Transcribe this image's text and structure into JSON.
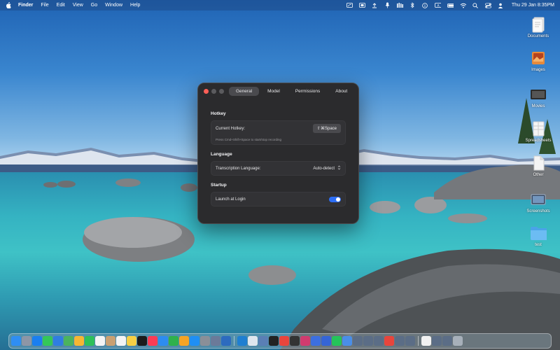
{
  "menubar": {
    "app_name": "Finder",
    "items": [
      "File",
      "Edit",
      "View",
      "Go",
      "Window",
      "Help"
    ],
    "status_icons": [
      "screen-record-icon",
      "screenshot-icon",
      "upload-icon",
      "microphone-icon",
      "audio-meter-icon",
      "bluetooth-icon",
      "info-icon",
      "input-source-icon",
      "battery-icon",
      "wifi-icon",
      "search-icon",
      "control-center-icon",
      "user-icon"
    ],
    "clock": "Thu 29 Jan  8:35PM"
  },
  "desktop": {
    "icons": [
      {
        "label": "Documents",
        "icon": "document-stack-icon"
      },
      {
        "label": "Images",
        "icon": "image-stack-icon"
      },
      {
        "label": "Movies",
        "icon": "movie-stack-icon"
      },
      {
        "label": "Spreadsheets",
        "icon": "spreadsheet-stack-icon"
      },
      {
        "label": "Other",
        "icon": "other-stack-icon"
      },
      {
        "label": "Screenshots",
        "icon": "screenshot-stack-icon"
      },
      {
        "label": "test",
        "icon": "folder-icon"
      }
    ]
  },
  "window": {
    "tabs": [
      {
        "label": "General",
        "active": true
      },
      {
        "label": "Model",
        "active": false
      },
      {
        "label": "Permissions",
        "active": false
      },
      {
        "label": "About",
        "active": false
      }
    ],
    "hotkey": {
      "section_title": "Hotkey",
      "label": "Current Hotkey:",
      "value": "⇧⌘Space",
      "hint": "Press Cmd+Shift+Space to start/stop recording"
    },
    "language": {
      "section_title": "Language",
      "label": "Transcription Language:",
      "value": "Auto-detect"
    },
    "startup": {
      "section_title": "Startup",
      "label": "Launch at Login",
      "enabled": true
    }
  },
  "dock": {
    "apps": [
      {
        "name": "finder-icon",
        "color": "#2f8ef3"
      },
      {
        "name": "launchpad-icon",
        "color": "#8d96a6"
      },
      {
        "name": "safari-icon",
        "color": "#1a7ff0"
      },
      {
        "name": "messages-icon",
        "color": "#34c759"
      },
      {
        "name": "mail-icon",
        "color": "#2f7de1"
      },
      {
        "name": "maps-icon",
        "color": "#4bb35e"
      },
      {
        "name": "photos-icon",
        "color": "#f7b633"
      },
      {
        "name": "facetime-icon",
        "color": "#2ec05a"
      },
      {
        "name": "calendar-icon",
        "color": "#f4f4f4"
      },
      {
        "name": "contacts-icon",
        "color": "#c9a072"
      },
      {
        "name": "reminders-icon",
        "color": "#f4f4f4"
      },
      {
        "name": "notes-icon",
        "color": "#f6cf45"
      },
      {
        "name": "appletv-icon",
        "color": "#1b1b1b"
      },
      {
        "name": "music-icon",
        "color": "#fa3c55"
      },
      {
        "name": "keynote-icon",
        "color": "#2d8cf0"
      },
      {
        "name": "numbers-icon",
        "color": "#2fb14c"
      },
      {
        "name": "pages-icon",
        "color": "#f5a423"
      },
      {
        "name": "app-store-icon",
        "color": "#1f8ff5"
      },
      {
        "name": "system-settings-icon",
        "color": "#8a8f98"
      },
      {
        "name": "book-icon",
        "color": "#6b7a99"
      },
      {
        "name": "dictionary-icon",
        "color": "#2d6bbf"
      },
      {
        "name": "sep",
        "color": ""
      },
      {
        "name": "vscode-icon",
        "color": "#1f7fd1"
      },
      {
        "name": "preview-icon",
        "color": "#dfe6ee"
      },
      {
        "name": "profile-icon",
        "color": "#5a7fb5"
      },
      {
        "name": "terminal-icon",
        "color": "#222"
      },
      {
        "name": "chrome-icon",
        "color": "#e8453c"
      },
      {
        "name": "activity-icon",
        "color": "#333"
      },
      {
        "name": "bookmark-icon",
        "color": "#d13b6f"
      },
      {
        "name": "todo-icon",
        "color": "#3c6fe0"
      },
      {
        "name": "password-icon",
        "color": "#3565d6"
      },
      {
        "name": "whatsapp-icon",
        "color": "#25c45a"
      },
      {
        "name": "folder-app-icon",
        "color": "#4a8ee8"
      },
      {
        "name": "window-app-icon",
        "color": "#5b6d86"
      },
      {
        "name": "window-app-2-icon",
        "color": "#5b6d86"
      },
      {
        "name": "window-app-3-icon",
        "color": "#5b6d86"
      },
      {
        "name": "chrome-2-icon",
        "color": "#e8453c"
      },
      {
        "name": "window-app-4-icon",
        "color": "#5b6d86"
      },
      {
        "name": "window-app-5-icon",
        "color": "#5b6d86"
      },
      {
        "name": "sep",
        "color": ""
      },
      {
        "name": "document-app-icon",
        "color": "#f1f1f1"
      },
      {
        "name": "window-app-6-icon",
        "color": "#5b6d86"
      },
      {
        "name": "window-app-7-icon",
        "color": "#5b6d86"
      },
      {
        "name": "trash-icon",
        "color": "#a7b0ba"
      }
    ]
  }
}
